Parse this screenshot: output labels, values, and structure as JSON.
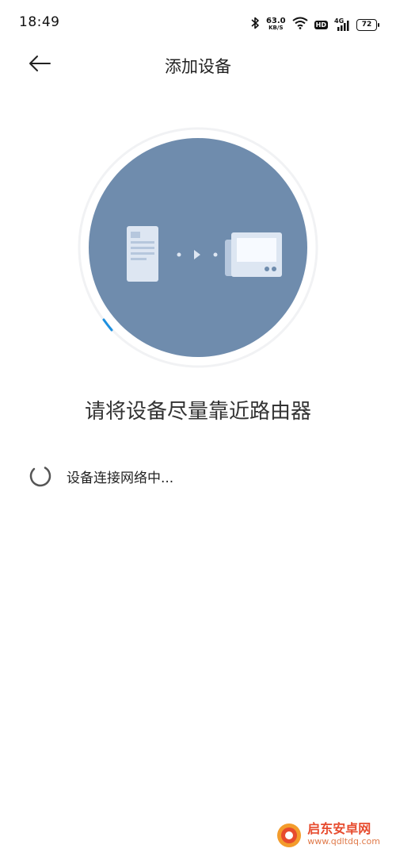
{
  "status_bar": {
    "time": "18:49",
    "net_speed_value": "63.0",
    "net_speed_unit": "KB/S",
    "hd_label": "HD",
    "network_label": "4G",
    "battery_level": "72",
    "icons": [
      "bluetooth-icon",
      "wifi-icon",
      "hd-icon",
      "signal-icon",
      "battery-icon"
    ]
  },
  "header": {
    "title": "添加设备",
    "back_icon": "arrow-left-icon"
  },
  "illustration": {
    "circle_color": "#6f8cad",
    "accent_color": "#1e90e0",
    "icons": [
      "phone-icon",
      "connection-dots-icon",
      "device-screen-icon"
    ]
  },
  "hint": "请将设备尽量靠近路由器",
  "connection": {
    "status_text": "设备连接网络中..."
  },
  "watermark": {
    "name": "启东安卓网",
    "url": "www.qdltdq.com"
  }
}
